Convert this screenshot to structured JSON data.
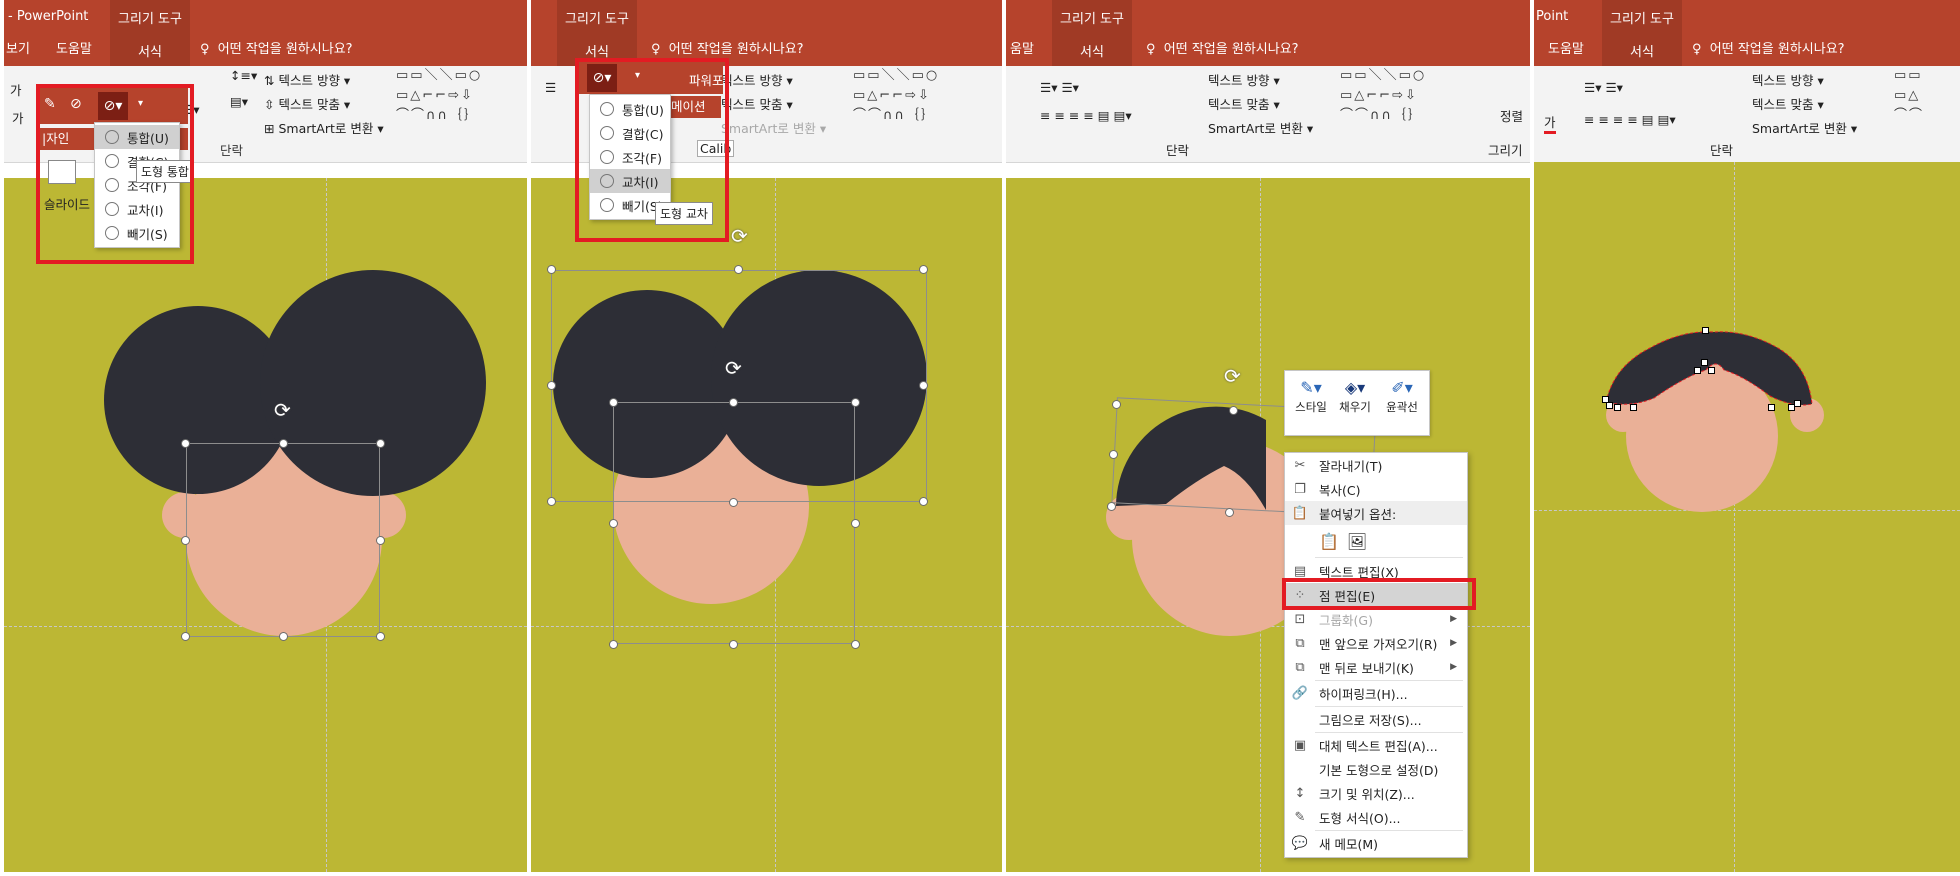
{
  "app_title": "- PowerPoint",
  "tool_tab_header": "그리기 도구",
  "tool_tab_format": "서식",
  "search_placeholder": "어떤 작업을 원하시나요?",
  "nav": {
    "view_partial": "보기",
    "help": "도움말",
    "point_partial": "Point",
    "help_partial": "움말"
  },
  "ribbon": {
    "text_direction": "텍스트 방향",
    "text_align": "텍스트 맞춤",
    "smartart": "SmartArt로 변환",
    "paragraph_group": "단락",
    "draw_group": "그리기",
    "arrange": "정렬",
    "slideshow_partial": "슬라이드",
    "design_partial": "|자인",
    "powerpoint_partial": "파워포",
    "animation_partial": "메이션",
    "font_box": "Calib",
    "font_letter": "가"
  },
  "merge_menu_1": {
    "items": [
      "통합(U)",
      "결합(C)",
      "조각(F)",
      "교차(I)",
      "빼기(S)"
    ],
    "tooltip": "도형 통합"
  },
  "merge_menu_2": {
    "items": [
      "통합(U)",
      "결합(C)",
      "조각(F)",
      "교차(I)",
      "빼기(S)"
    ],
    "tooltip": "도형 교차"
  },
  "mini_toolbar": {
    "style": "스타일",
    "fill": "채우기",
    "outline": "윤곽선"
  },
  "context_menu": {
    "cut": "잘라내기(T)",
    "copy": "복사(C)",
    "paste_options": "붙여넣기 옵션:",
    "edit_text": "텍스트 편집(X)",
    "edit_points": "점 편집(E)",
    "group": "그룹화(G)",
    "bring_front": "맨 앞으로 가져오기(R)",
    "send_back": "맨 뒤로 보내기(K)",
    "hyperlink": "하이퍼링크(H)...",
    "save_picture": "그림으로 저장(S)...",
    "alt_text": "대체 텍스트 편집(A)...",
    "default_shape": "기본 도형으로 설정(D)",
    "size_position": "크기 및 위치(Z)...",
    "format_shape": "도형 서식(O)...",
    "new_comment": "새 메모(M)"
  },
  "colors": {
    "ribbon_red": "#b6432c",
    "canvas": "#bcb734",
    "hair": "#2d2e36",
    "skin": "#eab097",
    "highlight": "#e31b23"
  },
  "icons": [
    "merge-shapes-icon",
    "rotate-handle-icon",
    "cut-icon",
    "copy-icon",
    "paste-icon",
    "edit-points-icon",
    "hyperlink-icon",
    "style-icon",
    "fill-bucket-icon",
    "outline-pen-icon",
    "search-lightbulb-icon"
  ]
}
